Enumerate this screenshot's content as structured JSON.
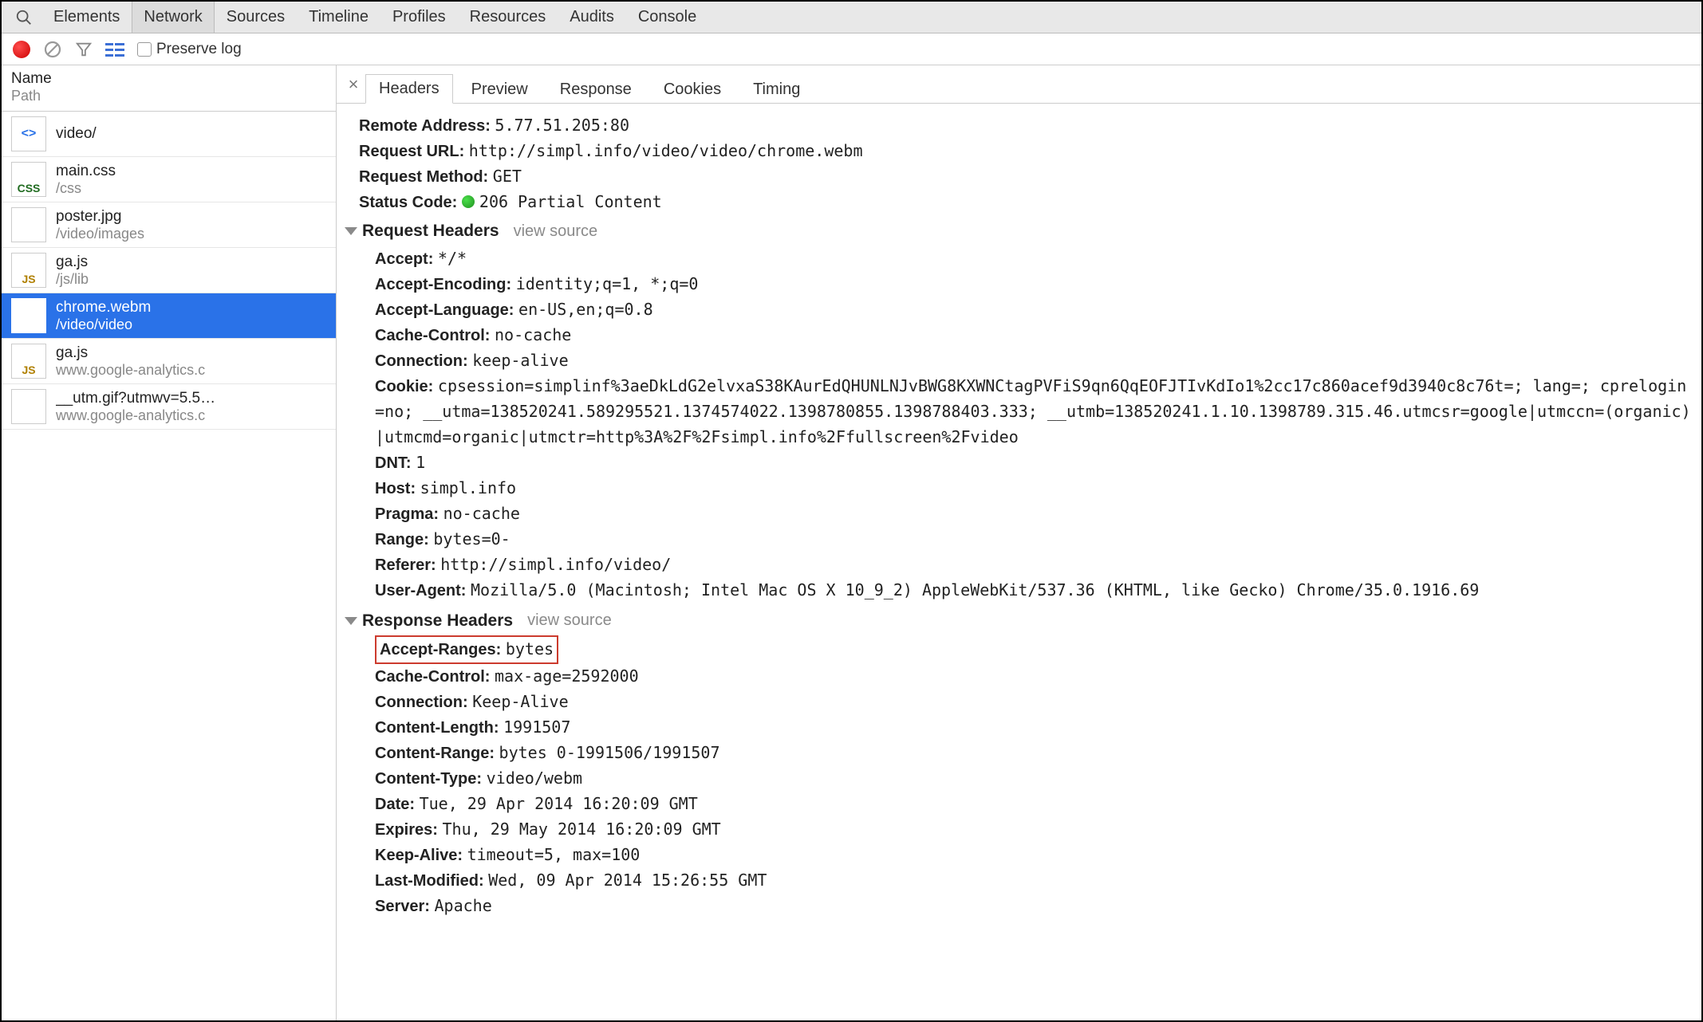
{
  "tabs": {
    "elements": "Elements",
    "network": "Network",
    "sources": "Sources",
    "timeline": "Timeline",
    "profiles": "Profiles",
    "resources": "Resources",
    "audits": "Audits",
    "console": "Console"
  },
  "toolbar": {
    "preserve_label": "Preserve log"
  },
  "left_header": {
    "name": "Name",
    "path": "Path"
  },
  "files": [
    {
      "name": "video/",
      "path": "",
      "type": "html"
    },
    {
      "name": "main.css",
      "path": "/css",
      "type": "css"
    },
    {
      "name": "poster.jpg",
      "path": "/video/images",
      "type": "img"
    },
    {
      "name": "ga.js",
      "path": "/js/lib",
      "type": "js"
    },
    {
      "name": "chrome.webm",
      "path": "/video/video",
      "type": "blank",
      "selected": true
    },
    {
      "name": "ga.js",
      "path": "www.google-analytics.c",
      "type": "js"
    },
    {
      "name": "__utm.gif?utmwv=5.5…",
      "path": "www.google-analytics.c",
      "type": "blank"
    }
  ],
  "detail_tabs": {
    "headers": "Headers",
    "preview": "Preview",
    "response": "Response",
    "cookies": "Cookies",
    "timing": "Timing"
  },
  "summary": {
    "remote_label": "Remote Address:",
    "remote_val": "5.77.51.205:80",
    "url_label": "Request URL:",
    "url_val": "http://simpl.info/video/video/chrome.webm",
    "method_label": "Request Method:",
    "method_val": "GET",
    "status_label": "Status Code:",
    "status_val": "206 Partial Content"
  },
  "sections": {
    "req_title": "Request Headers",
    "resp_title": "Response Headers",
    "view_source": "view source"
  },
  "req": {
    "accept_k": "Accept:",
    "accept_v": "*/*",
    "ae_k": "Accept-Encoding:",
    "ae_v": "identity;q=1, *;q=0",
    "al_k": "Accept-Language:",
    "al_v": "en-US,en;q=0.8",
    "cc_k": "Cache-Control:",
    "cc_v": "no-cache",
    "conn_k": "Connection:",
    "conn_v": "keep-alive",
    "cookie_k": "Cookie:",
    "cookie_v": "cpsession=simplinf%3aeDkLdG2elvxaS38KAurEdQHUNLNJvBWG8KXWNCtagPVFiS9qn6QqEOFJTIvKdIo1%2cc17c860acef9d3940c8c76t=; lang=; cprelogin=no; __utma=138520241.589295521.1374574022.1398780855.1398788403.333; __utmb=138520241.1.10.1398789.315.46.utmcsr=google|utmccn=(organic)|utmcmd=organic|utmctr=http%3A%2F%2Fsimpl.info%2Ffullscreen%2Fvideo",
    "dnt_k": "DNT:",
    "dnt_v": "1",
    "host_k": "Host:",
    "host_v": "simpl.info",
    "pragma_k": "Pragma:",
    "pragma_v": "no-cache",
    "range_k": "Range:",
    "range_v": "bytes=0-",
    "ref_k": "Referer:",
    "ref_v": "http://simpl.info/video/",
    "ua_k": "User-Agent:",
    "ua_v": "Mozilla/5.0 (Macintosh; Intel Mac OS X 10_9_2) AppleWebKit/537.36 (KHTML, like Gecko) Chrome/35.0.1916.69"
  },
  "resp": {
    "ar_k": "Accept-Ranges:",
    "ar_v": "bytes",
    "cc_k": "Cache-Control:",
    "cc_v": "max-age=2592000",
    "conn_k": "Connection:",
    "conn_v": "Keep-Alive",
    "cl_k": "Content-Length:",
    "cl_v": "1991507",
    "cr_k": "Content-Range:",
    "cr_v": "bytes 0-1991506/1991507",
    "ct_k": "Content-Type:",
    "ct_v": "video/webm",
    "date_k": "Date:",
    "date_v": "Tue, 29 Apr 2014 16:20:09 GMT",
    "exp_k": "Expires:",
    "exp_v": "Thu, 29 May 2014 16:20:09 GMT",
    "ka_k": "Keep-Alive:",
    "ka_v": "timeout=5, max=100",
    "lm_k": "Last-Modified:",
    "lm_v": "Wed, 09 Apr 2014 15:26:55 GMT",
    "srv_k": "Server:",
    "srv_v": "Apache"
  }
}
